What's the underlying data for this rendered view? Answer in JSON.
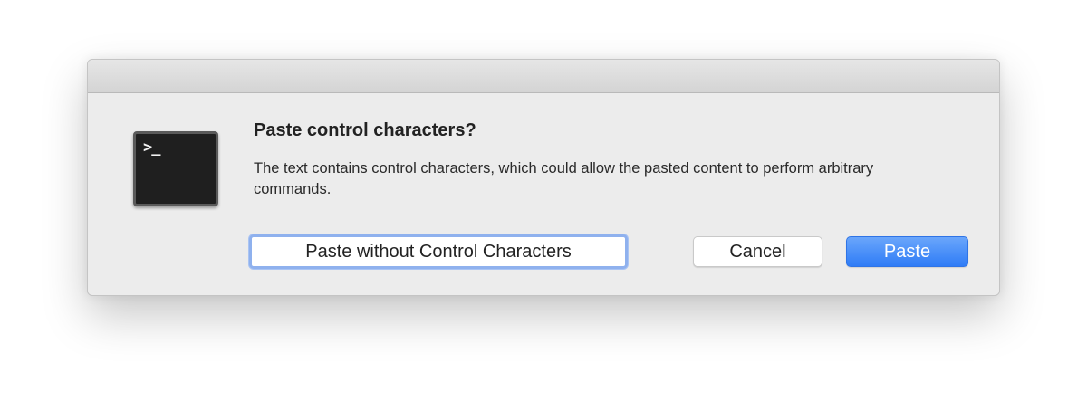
{
  "dialog": {
    "app_icon": "terminal-icon",
    "app_icon_prompt": ">_",
    "title": "Paste control characters?",
    "message": "The text contains control characters, which could allow the pasted content to perform arbitrary commands.",
    "buttons": {
      "paste_without_control": "Paste without Control Characters",
      "cancel": "Cancel",
      "paste": "Paste"
    }
  },
  "colors": {
    "accent": "#3b82f7",
    "focus_ring": "#8fb1ee"
  }
}
